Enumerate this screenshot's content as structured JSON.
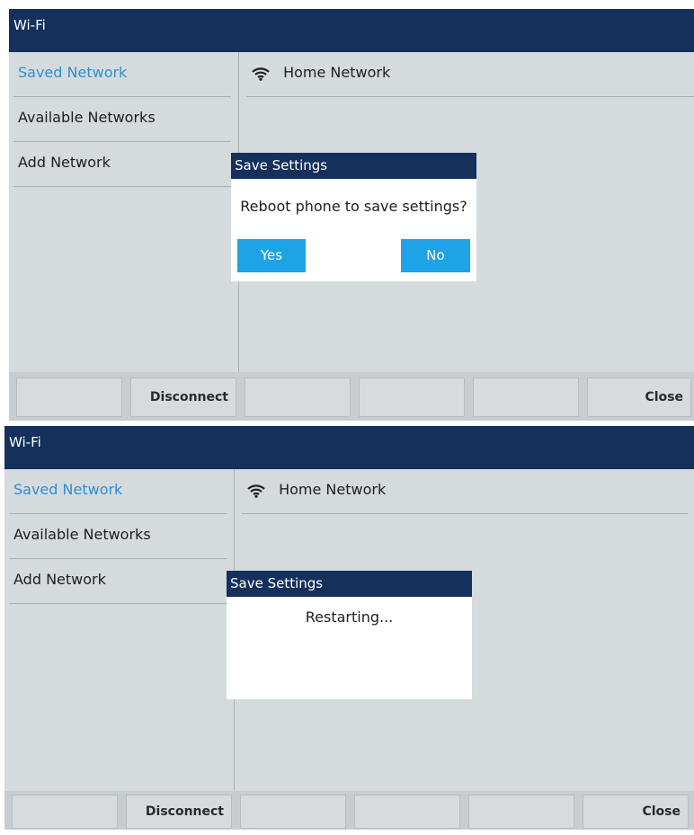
{
  "panels": [
    {
      "title": "Wi-Fi",
      "sidebar": {
        "items": [
          "Saved Network",
          "Available Networks",
          "Add Network"
        ]
      },
      "network": {
        "icon": "wifi-icon",
        "name": "Home Network"
      },
      "dialog": {
        "title": "Save Settings",
        "message": "Reboot phone to save settings?",
        "yes_label": "Yes",
        "no_label": "No"
      },
      "softkeys": [
        "",
        "Disconnect",
        "",
        "",
        "",
        "Close"
      ]
    },
    {
      "title": "Wi-Fi",
      "sidebar": {
        "items": [
          "Saved Network",
          "Available Networks",
          "Add Network"
        ]
      },
      "network": {
        "icon": "wifi-icon",
        "name": "Home Network"
      },
      "dialog": {
        "title": "Save Settings",
        "message": "Restarting..."
      },
      "softkeys": [
        "",
        "Disconnect",
        "",
        "",
        "",
        "Close"
      ]
    }
  ],
  "colors": {
    "titlebar": "#14305b",
    "accent": "#2f8fcf",
    "button": "#1ea3e6",
    "background": "#d5dadd"
  }
}
